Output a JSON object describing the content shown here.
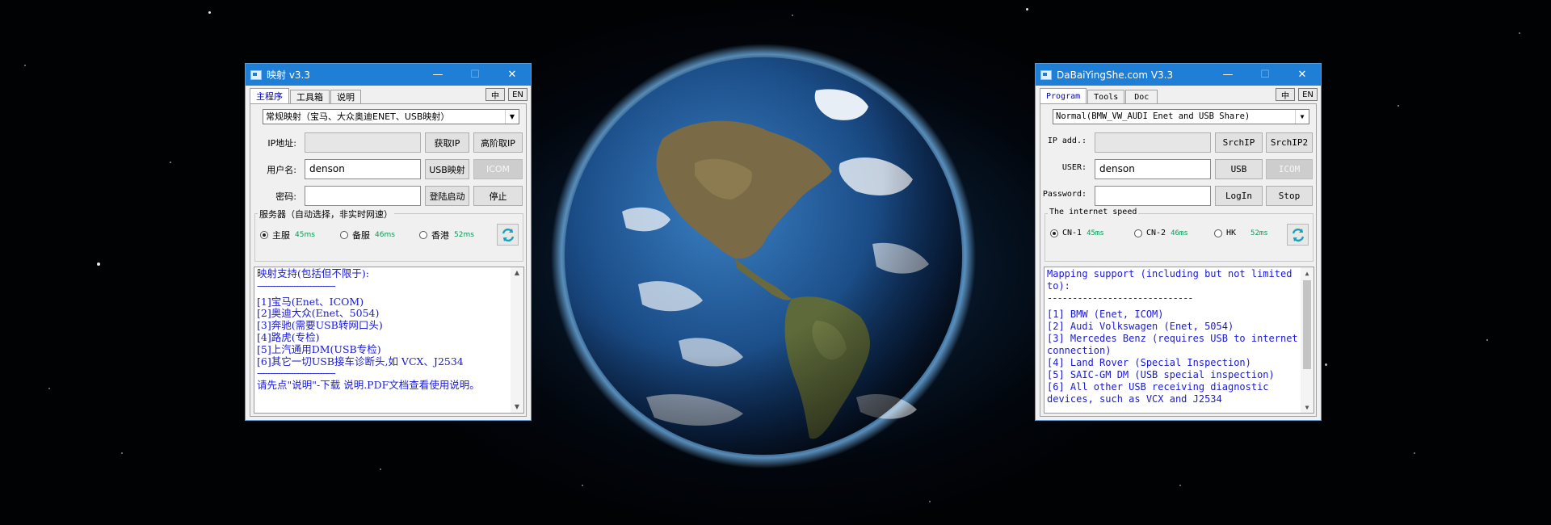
{
  "colors": {
    "title_bar": "#1f7fd6",
    "accent_text": "#1a1ad6",
    "latency": "#0a9a5a"
  },
  "left": {
    "title": "映射 v3.3",
    "tabs": [
      "主程序",
      "工具箱",
      "说明"
    ],
    "lang": [
      "中",
      "EN"
    ],
    "mode_select": "常规映射（宝马、大众奥迪ENET、USB映射）",
    "ip_label": "IP地址:",
    "user_label": "用户名:",
    "password_label": "密码:",
    "ip_value": "",
    "user_value": "denson",
    "password_value": "",
    "btn_get_ip": "获取IP",
    "btn_adv_ip": "高阶取IP",
    "btn_usb": "USB映射",
    "btn_icom": "ICOM",
    "btn_login": "登陆启动",
    "btn_stop": "停止",
    "group_title": "服务器（自动选择，非实时网速）",
    "servers": [
      {
        "name": "主服",
        "latency": "45ms",
        "selected": true
      },
      {
        "name": "备服",
        "latency": "46ms",
        "selected": false
      },
      {
        "name": "香港",
        "latency": "52ms",
        "selected": false
      }
    ],
    "info": {
      "heading": "映射支持(包括但不限于):",
      "separator": "------------------------------",
      "items": [
        "[1]宝马(Enet、ICOM)",
        "[2]奥迪大众(Enet、5054)",
        "[3]奔驰(需要USB转网口头)",
        "[4]路虎(专检)",
        "[5]上汽通用DM(USB专检)",
        "[6]其它一切USB接车诊断头,如 VCX、J2534"
      ],
      "separator2": "------------------------------",
      "note": "请先点\"说明\"-下载 说明.PDF文档查看使用说明。"
    }
  },
  "right": {
    "title": "DaBaiYingShe.com V3.3",
    "tabs": [
      "Program",
      "Tools",
      "Doc"
    ],
    "lang": [
      "中",
      "EN"
    ],
    "mode_select": "Normal(BMW_VW_AUDI Enet and USB Share)",
    "ip_label": "IP add.:",
    "user_label": "USER:",
    "password_label": "Password:",
    "ip_value": "",
    "user_value": "denson",
    "password_value": "",
    "btn_srchip": "SrchIP",
    "btn_srchip2": "SrchIP2",
    "btn_usb": "USB",
    "btn_icom": "ICOM",
    "btn_login": "LogIn",
    "btn_stop": "Stop",
    "group_title": "The internet speed",
    "servers": [
      {
        "name": "CN-1",
        "latency": "45ms",
        "selected": true
      },
      {
        "name": "CN-2",
        "latency": "46ms",
        "selected": false
      },
      {
        "name": "HK",
        "latency": "52ms",
        "selected": false
      }
    ],
    "info": {
      "heading": "Mapping support (including but not limited to):",
      "separator": "-----------------------------",
      "items": [
        "[1] BMW (Enet, ICOM)",
        "[2] Audi Volkswagen (Enet, 5054)",
        "[3] Mercedes Benz (requires USB to internet connection)",
        "[4] Land Rover (Special Inspection)",
        "[5] SAIC-GM DM (USB special inspection)",
        "[6] All other USB receiving diagnostic devices, such as VCX and J2534"
      ]
    }
  }
}
